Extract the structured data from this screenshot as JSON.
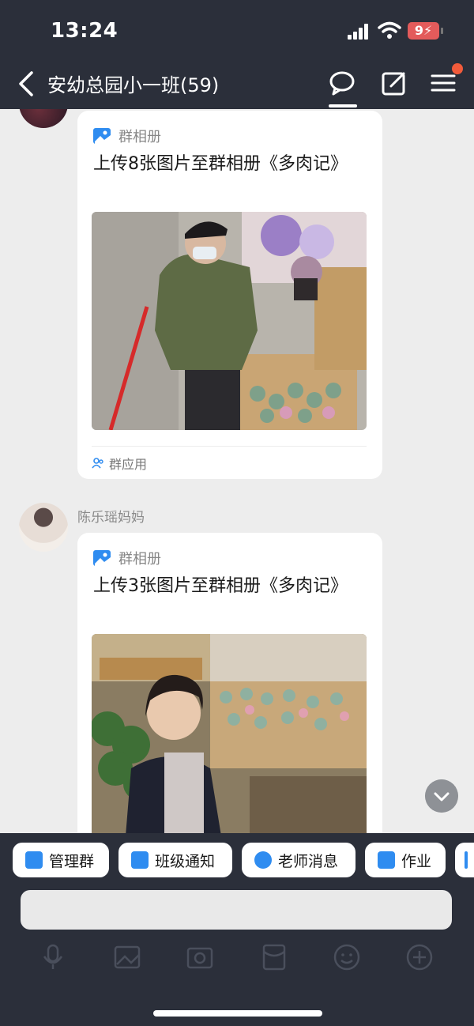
{
  "status": {
    "time": "13:24",
    "battery": "9"
  },
  "header": {
    "title": "安幼总园小一班(59)"
  },
  "messages": [
    {
      "app_name": "群相册",
      "title": "上传8张图片至群相册《多肉记》",
      "footer": "群应用"
    },
    {
      "sender": "陈乐瑶妈妈",
      "app_name": "群相册",
      "title": "上传3张图片至群相册《多肉记》"
    }
  ],
  "quick_actions": [
    "管理群",
    "班级通知",
    "老师消息",
    "作业"
  ],
  "colors": {
    "app_blue": "#2f8cf0",
    "badge_red": "#f25b3b",
    "bar_bg": "#2b2f3a"
  }
}
